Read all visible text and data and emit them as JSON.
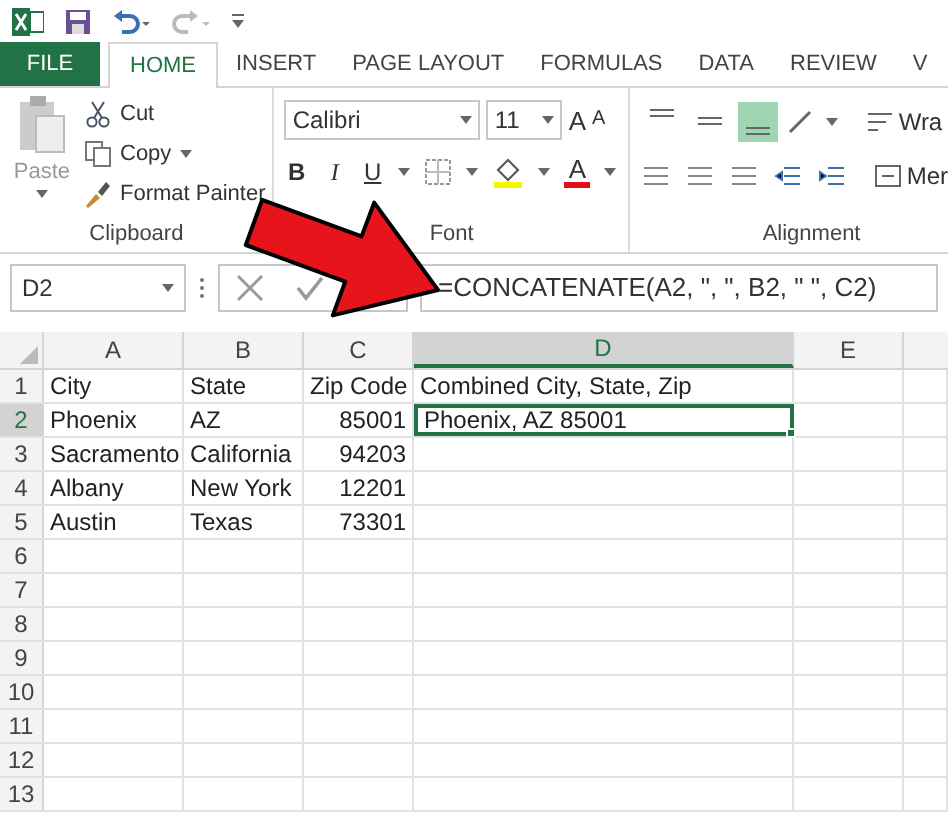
{
  "ribbon_tabs": [
    {
      "label": "FILE",
      "kind": "file",
      "selected": false
    },
    {
      "label": "HOME",
      "kind": "tab",
      "selected": true
    },
    {
      "label": "INSERT",
      "kind": "tab",
      "selected": false
    },
    {
      "label": "PAGE LAYOUT",
      "kind": "tab",
      "selected": false
    },
    {
      "label": "FORMULAS",
      "kind": "tab",
      "selected": false
    },
    {
      "label": "DATA",
      "kind": "tab",
      "selected": false
    },
    {
      "label": "REVIEW",
      "kind": "tab",
      "selected": false
    },
    {
      "label": "V",
      "kind": "tab",
      "selected": false
    }
  ],
  "clipboard": {
    "paste": "Paste",
    "cut": "Cut",
    "copy": "Copy",
    "format_painter": "Format Painter",
    "label": "Clipboard"
  },
  "font": {
    "name": "Calibri",
    "size": "11",
    "grow": "A",
    "shrink": "A",
    "bold": "B",
    "italic": "I",
    "underline": "U",
    "font_color": "A",
    "label": "Font"
  },
  "alignment": {
    "vertical": [
      {
        "selected": false
      },
      {
        "selected": false
      },
      {
        "selected": true
      }
    ],
    "wrap": "Wra",
    "merge": "Mer",
    "label": "Alignment"
  },
  "formula_bar": {
    "name_box": "D2",
    "formula": "=CONCATENATE(A2, \", \", B2, \" \", C2)"
  },
  "sheet": {
    "columns": [
      {
        "label": "A",
        "selected": false
      },
      {
        "label": "B",
        "selected": false
      },
      {
        "label": "C",
        "selected": false
      },
      {
        "label": "D",
        "selected": true
      },
      {
        "label": "E",
        "selected": false
      }
    ],
    "rows": [
      {
        "number": "1",
        "selected": false,
        "cells": [
          {
            "text": "City",
            "kind": "text",
            "selected": false
          },
          {
            "text": "State",
            "kind": "text",
            "selected": false
          },
          {
            "text": "Zip Code",
            "kind": "text",
            "selected": false
          },
          {
            "text": "Combined City, State, Zip",
            "kind": "text",
            "selected": false
          }
        ]
      },
      {
        "number": "2",
        "selected": true,
        "cells": [
          {
            "text": "Phoenix",
            "kind": "text",
            "selected": false
          },
          {
            "text": "AZ",
            "kind": "text",
            "selected": false
          },
          {
            "text": "85001",
            "kind": "number",
            "selected": false
          },
          {
            "text": "Phoenix, AZ 85001",
            "kind": "text",
            "selected": true
          }
        ]
      },
      {
        "number": "3",
        "selected": false,
        "cells": [
          {
            "text": "Sacramento",
            "kind": "text",
            "selected": false
          },
          {
            "text": "California",
            "kind": "text",
            "selected": false
          },
          {
            "text": "94203",
            "kind": "number",
            "selected": false
          }
        ]
      },
      {
        "number": "4",
        "selected": false,
        "cells": [
          {
            "text": "Albany",
            "kind": "text",
            "selected": false
          },
          {
            "text": "New York",
            "kind": "text",
            "selected": false
          },
          {
            "text": "12201",
            "kind": "number",
            "selected": false
          }
        ]
      },
      {
        "number": "5",
        "selected": false,
        "cells": [
          {
            "text": "Austin",
            "kind": "text",
            "selected": false
          },
          {
            "text": "Texas",
            "kind": "text",
            "selected": false
          },
          {
            "text": "73301",
            "kind": "number",
            "selected": false
          }
        ]
      },
      {
        "number": "6",
        "selected": false
      },
      {
        "number": "7",
        "selected": false
      },
      {
        "number": "8",
        "selected": false
      },
      {
        "number": "9",
        "selected": false
      },
      {
        "number": "10",
        "selected": false
      },
      {
        "number": "11",
        "selected": false
      },
      {
        "number": "12",
        "selected": false
      },
      {
        "number": "13",
        "selected": false
      }
    ]
  }
}
